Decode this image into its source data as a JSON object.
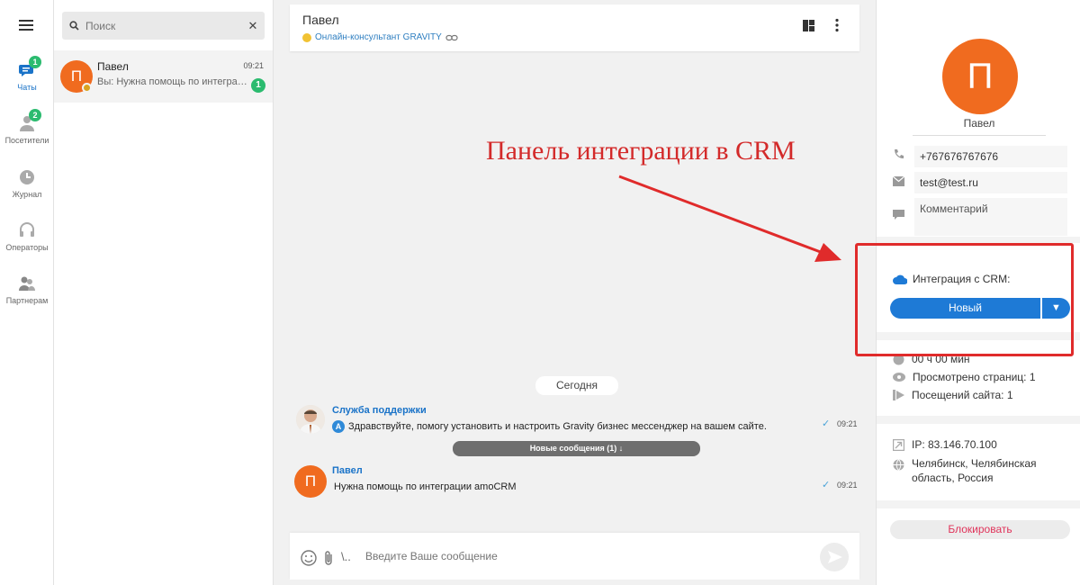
{
  "nav": {
    "items": [
      {
        "label": "Чаты",
        "badge": "1",
        "active": true
      },
      {
        "label": "Посетители",
        "badge": "2"
      },
      {
        "label": "Журнал"
      },
      {
        "label": "Операторы"
      },
      {
        "label": "Партнерам"
      }
    ]
  },
  "search": {
    "placeholder": "Поиск"
  },
  "chat_list": [
    {
      "name": "Павел",
      "initial": "П",
      "time": "09:21",
      "preview": "Вы: Нужна помощь по интеграции amoCRM",
      "unread": "1"
    }
  ],
  "header": {
    "title": "Павел",
    "subtitle": "Онлайн-консультант GRAVITY"
  },
  "annotation": {
    "text": "Панель интеграции в CRM"
  },
  "conversation": {
    "date_divider": "Сегодня",
    "new_messages": "Новые сообщения (1) ↓",
    "messages": [
      {
        "from": "Служба поддержки",
        "badge": "A",
        "text": "Здравствуйте, помогу установить и настроить Gravity бизнес мессенджер на вашем сайте.",
        "time": "09:21"
      },
      {
        "from": "Павел",
        "initial": "П",
        "text": "Нужна помощь по интеграции amoCRM",
        "time": "09:21"
      }
    ]
  },
  "composer": {
    "placeholder": "Введите Ваше сообщение",
    "mention": "\\.."
  },
  "visitor": {
    "initial": "П",
    "name": "Павел",
    "phone": "+767676767676",
    "email": "test@test.ru",
    "comment_placeholder": "Комментарий",
    "crm_label": "Интеграция с CRM:",
    "crm_status": "Новый",
    "crm_dropdown": "▼",
    "duration": "00 ч 00 мин",
    "pages_viewed": "Просмотрено страниц: 1",
    "site_visits": "Посещений сайта: 1",
    "ip": "IP: 83.146.70.100",
    "location": "Челябинск, Челябинская область, Россия",
    "block_label": "Блокировать"
  },
  "colors": {
    "accent": "#1e7ad6",
    "avatar": "#f06b1f",
    "badge": "#2bbb6f",
    "annotation": "#d32a2a"
  }
}
